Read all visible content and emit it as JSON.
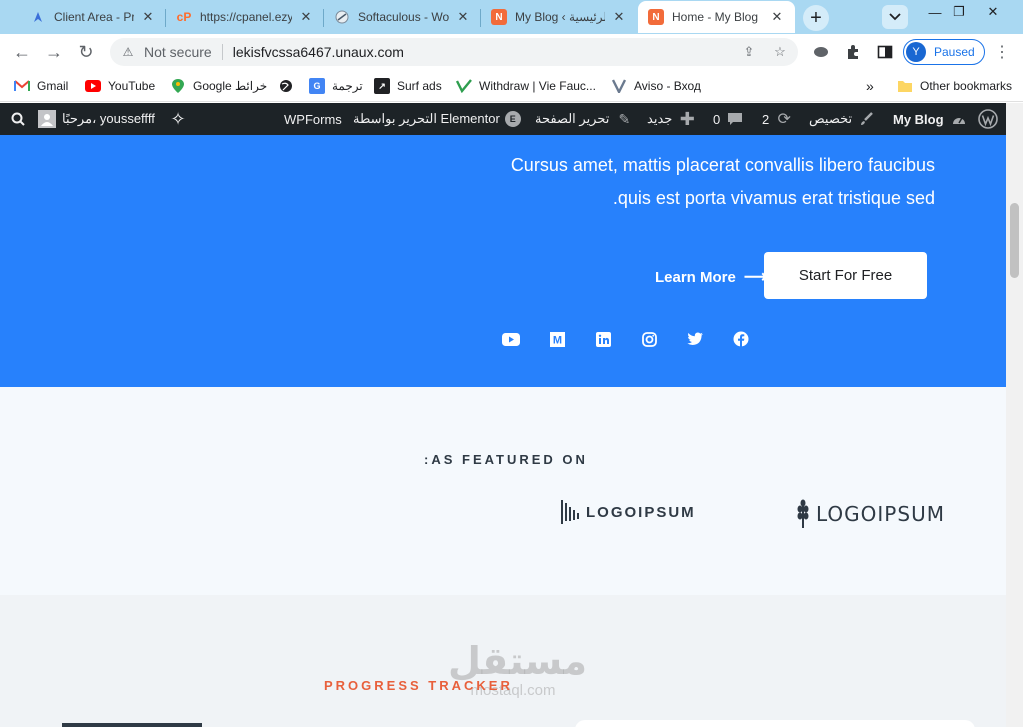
{
  "tabs": [
    {
      "title": "Client Area - ProF",
      "icon": "profreehost-icon",
      "active": false
    },
    {
      "title": "https://cpanel.ezy",
      "icon": "cpanel-icon",
      "active": false
    },
    {
      "title": "Softaculous - Wo",
      "icon": "softaculous-icon",
      "active": false
    },
    {
      "title": "My Blog ‹ الرئيسية",
      "icon": "blog-icon",
      "active": false
    },
    {
      "title": "Home - My Blog",
      "icon": "blog-icon",
      "active": true
    }
  ],
  "toolbar": {
    "security_label": "Not secure",
    "url": "lekisfvcssa6467.unaux.com",
    "profile_initial": "Y",
    "profile_status": "Paused"
  },
  "bookmarks": [
    {
      "label": "Gmail",
      "icon": "gmail-icon"
    },
    {
      "label": "YouTube",
      "icon": "youtube-icon"
    },
    {
      "label": "Google خرائط",
      "icon": "google-maps-icon"
    },
    {
      "label": "",
      "icon": "globe-icon"
    },
    {
      "label": "ترجمة",
      "icon": "google-translate-icon"
    },
    {
      "label": "Surf ads",
      "icon": "surf-ads-icon"
    },
    {
      "label": "Withdraw | Vie Fauc...",
      "icon": "viefaucet-icon"
    },
    {
      "label": "Aviso - Вход",
      "icon": "aviso-icon"
    }
  ],
  "bookmarks_overflow": "»",
  "other_bookmarks": "Other bookmarks",
  "adminbar": {
    "site_name": "My Blog",
    "customize": "تخصيص",
    "updates_count": "2",
    "comments_count": "0",
    "new": "جديد",
    "edit_page": "تحرير الصفحة",
    "edit_with_elementor": "التحرير بواسطة Elementor",
    "wpforms": "WPForms",
    "greeting": "مرحبًا، yousseffff"
  },
  "hero": {
    "text_line1": "Cursus amet, mattis placerat convallis libero faucibus",
    "text_line2": "quis est porta vivamus erat tristique sed.",
    "learn_more": "Learn More",
    "start_for_free": "Start For Free",
    "social": [
      "youtube-icon",
      "medium-icon",
      "linkedin-icon",
      "instagram-icon",
      "twitter-icon",
      "facebook-icon"
    ]
  },
  "featured": {
    "heading": ":AS FEATURED ON",
    "logo1": "LOGOIPSUM",
    "logo2": "LOGOIPSUM"
  },
  "progress_heading": "PROGRESS TRACKER",
  "watermark": {
    "arabic": "مستقل",
    "latin": "mostaql.com"
  },
  "colors": {
    "hero_blue": "#2781fc",
    "adminbar": "#1d2327",
    "accent_orange": "#e8603c",
    "tabstrip": "#a9d8f2"
  }
}
